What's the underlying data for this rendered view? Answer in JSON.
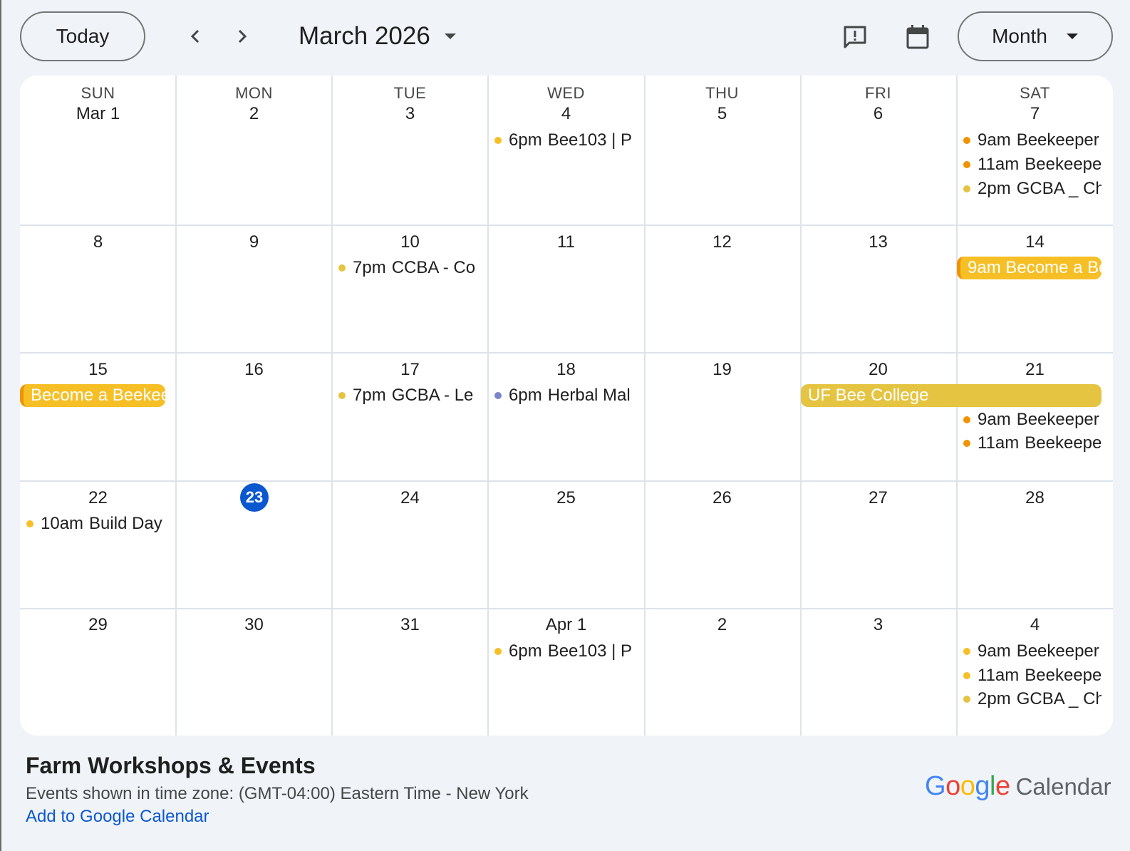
{
  "toolbar": {
    "today_label": "Today",
    "prev_icon": "chevron-left-icon",
    "next_icon": "chevron-right-icon",
    "title": "March 2026",
    "feedback_icon": "feedback-icon",
    "calendar_icon": "calendar-icon",
    "view_label": "Month"
  },
  "weekdays": [
    "SUN",
    "MON",
    "TUE",
    "WED",
    "THU",
    "FRI",
    "SAT"
  ],
  "weeks": [
    [
      "Mar 1",
      "2",
      "3",
      "4",
      "5",
      "6",
      "7"
    ],
    [
      "8",
      "9",
      "10",
      "11",
      "12",
      "13",
      "14"
    ],
    [
      "15",
      "16",
      "17",
      "18",
      "19",
      "20",
      "21"
    ],
    [
      "22",
      "23",
      "24",
      "25",
      "26",
      "27",
      "28"
    ],
    [
      "29",
      "30",
      "31",
      "Apr 1",
      "2",
      "3",
      "4"
    ]
  ],
  "today_date": "23",
  "events": {
    "w0_wed": {
      "time": "6pm",
      "title": "Bee103 | P"
    },
    "w0_sat_1": {
      "time": "9am",
      "title": "Beekeeper"
    },
    "w0_sat_2": {
      "time": "11am",
      "title": "Beekeepe"
    },
    "w0_sat_3": {
      "time": "2pm",
      "title": "GCBA _ Ch"
    },
    "w1_tue": {
      "time": "7pm",
      "title": "CCBA - Co"
    },
    "w1_sat_chip": "9am Become a Be",
    "w2_sun_chip": "Become a Beekee",
    "w2_tue": {
      "time": "7pm",
      "title": "GCBA - Le"
    },
    "w2_wed": {
      "time": "6pm",
      "title": "Herbal Mal"
    },
    "w2_fri_chip": "UF Bee College",
    "w2_sat_1": {
      "time": "9am",
      "title": "Beekeeper"
    },
    "w2_sat_2": {
      "time": "11am",
      "title": "Beekeepe"
    },
    "w3_sun": {
      "time": "10am",
      "title": "Build Day"
    },
    "w4_wed": {
      "time": "6pm",
      "title": "Bee103 | P"
    },
    "w4_sat_1": {
      "time": "9am",
      "title": "Beekeeper"
    },
    "w4_sat_2": {
      "time": "11am",
      "title": "Beekeepe"
    },
    "w4_sat_3": {
      "time": "2pm",
      "title": "GCBA _ Ch"
    }
  },
  "colors": {
    "yellow_dot": "#f6bf26",
    "orange_dot": "#f09300",
    "gold_dot": "#e4c441",
    "lavender_dot": "#7986cb",
    "today_blue": "#0b57d0"
  },
  "footer": {
    "title": "Farm Workshops & Events",
    "timezone": "Events shown in time zone: (GMT-04:00) Eastern Time - New York",
    "add_link": "Add to Google Calendar",
    "logo_google": "Google",
    "logo_calendar": "Calendar"
  }
}
